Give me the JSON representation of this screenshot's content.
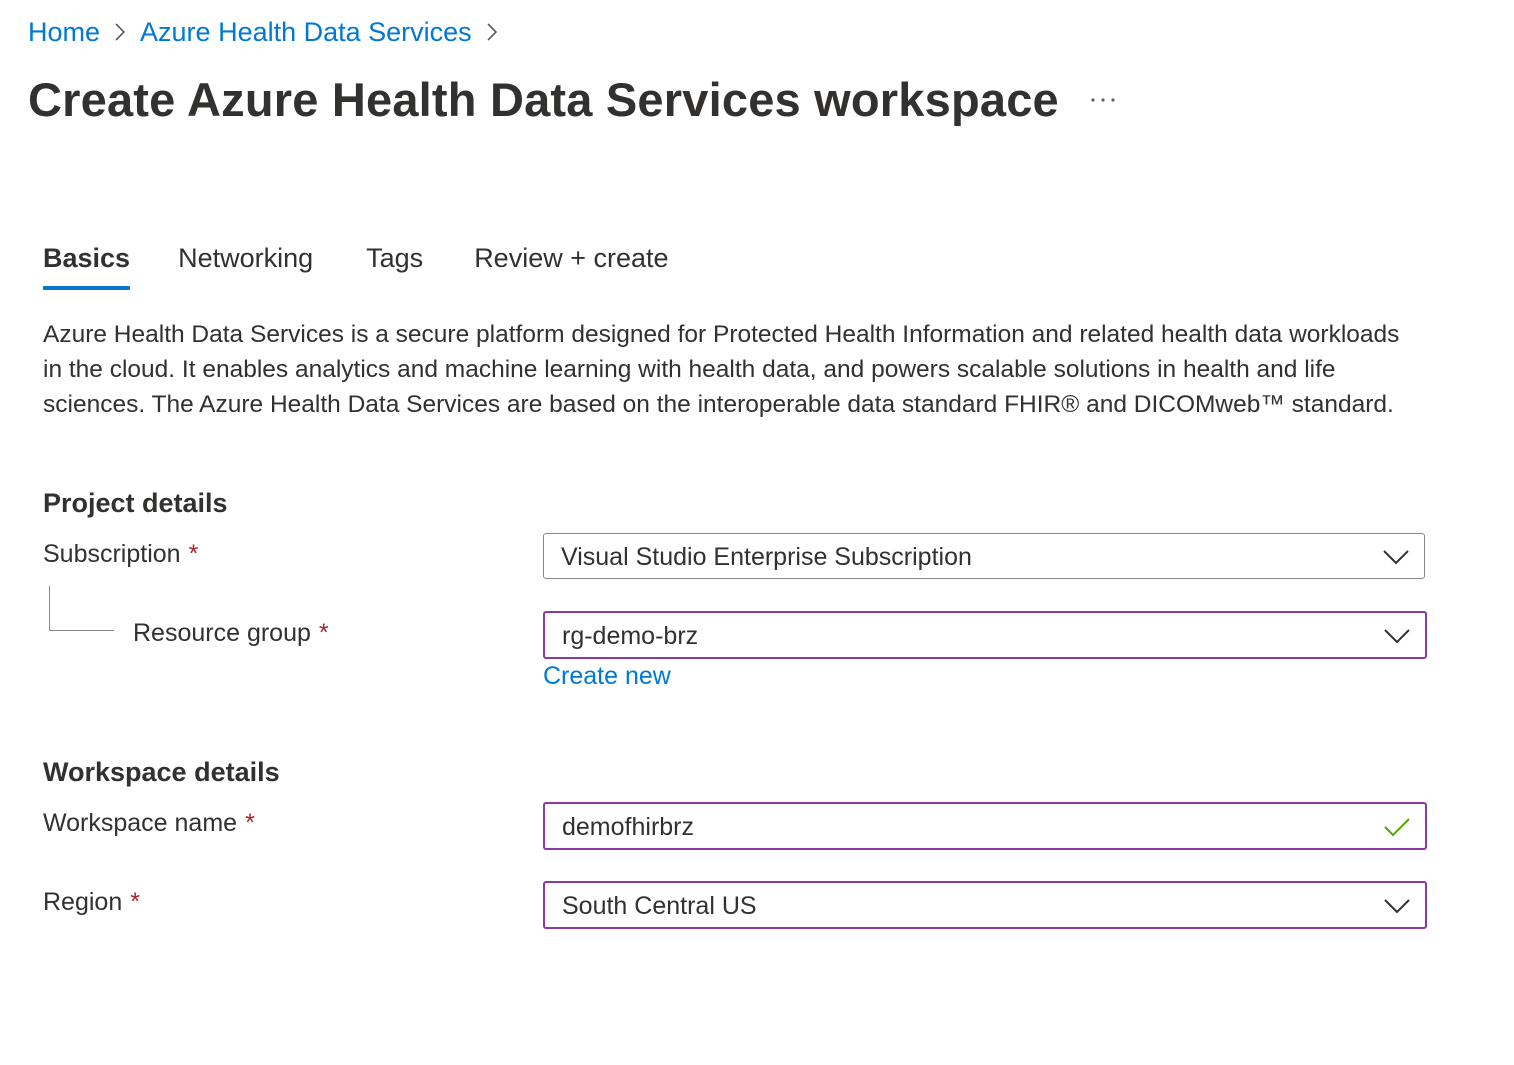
{
  "breadcrumb": {
    "items": [
      "Home",
      "Azure Health Data Services"
    ]
  },
  "header": {
    "title": "Create Azure Health Data Services workspace",
    "more_label": "..."
  },
  "tabs": [
    {
      "label": "Basics",
      "active": true
    },
    {
      "label": "Networking",
      "active": false
    },
    {
      "label": "Tags",
      "active": false
    },
    {
      "label": "Review + create",
      "active": false
    }
  ],
  "description": "Azure Health Data Services is a secure platform designed for Protected Health Information and related health data workloads in the cloud. It enables analytics and machine learning with health data, and powers scalable solutions in health and life sciences. The Azure Health Data Services are based on the interoperable data standard FHIR® and DICOMweb™ standard.",
  "project_details": {
    "heading": "Project details",
    "subscription": {
      "label": "Subscription",
      "required_mark": "*",
      "value": "Visual Studio Enterprise Subscription",
      "icon": "chevron-down-icon"
    },
    "resource_group": {
      "label": "Resource group",
      "required_mark": "*",
      "value": "rg-demo-brz",
      "icon": "chevron-down-icon"
    },
    "create_new_label": "Create new"
  },
  "workspace_details": {
    "heading": "Workspace details",
    "workspace_name": {
      "label": "Workspace name",
      "required_mark": "*",
      "value": "demofhirbrz",
      "icon": "checkmark-icon"
    },
    "region": {
      "label": "Region",
      "required_mark": "*",
      "value": "South Central US",
      "icon": "chevron-down-icon"
    }
  },
  "colors": {
    "link": "#0078d4",
    "required": "#a4262c",
    "focused_border": "#8a3c9e",
    "valid_check": "#57a300",
    "text": "#323130"
  }
}
